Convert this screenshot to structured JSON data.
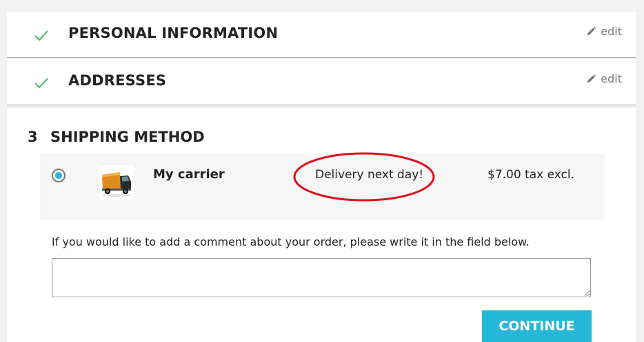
{
  "steps": {
    "personal": {
      "title": "PERSONAL INFORMATION",
      "edit_label": "edit",
      "status_icon": "check-icon"
    },
    "addresses": {
      "title": "ADDRESSES",
      "edit_label": "edit",
      "status_icon": "check-icon"
    },
    "shipping": {
      "number": "3",
      "title": "SHIPPING METHOD"
    }
  },
  "carrier": {
    "selected": true,
    "logo_icon": "truck-icon",
    "name": "My carrier",
    "delay": "Delivery next day!",
    "price": "$7.00 tax excl."
  },
  "comment": {
    "label": "If you would like to add a comment about your order, please write it in the field below.",
    "value": ""
  },
  "actions": {
    "continue_label": "CONTINUE"
  },
  "colors": {
    "accent": "#25b9d7",
    "check": "#4cbb6c",
    "annotation": "#e0101a"
  }
}
